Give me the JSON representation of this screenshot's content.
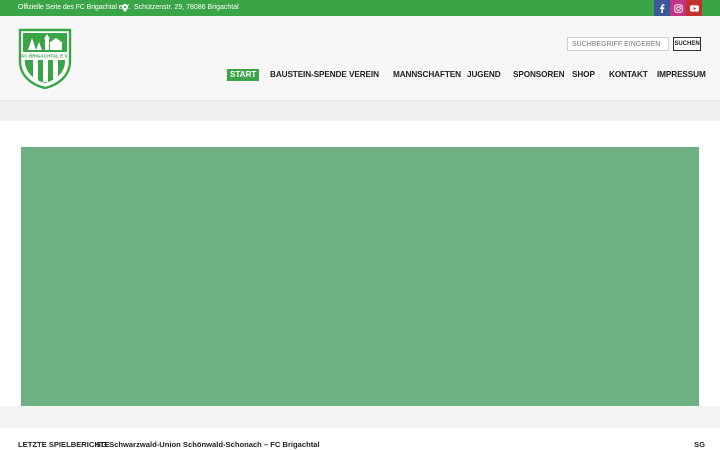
{
  "topbar": {
    "tagline": "Offizielle Seite des FC Brigachtal e.V.",
    "address": "Schützenstr. 29, 78086 Brigachtal",
    "social": [
      "facebook-icon",
      "instagram-icon",
      "youtube-icon"
    ],
    "background_color": "#3aa547"
  },
  "header": {
    "logo_text": "FC BRIGACHTAL E.V.",
    "search": {
      "placeholder": "SUCHBEGRIFF EINGEBEN",
      "value": "",
      "button_label": "SUCHEN"
    }
  },
  "nav": {
    "items": [
      {
        "label": "START",
        "active": true
      },
      {
        "label": "BAUSTEIN-SPENDE",
        "active": false
      },
      {
        "label": "VEREIN",
        "active": false
      },
      {
        "label": "MANNSCHAFTEN",
        "active": false
      },
      {
        "label": "JUGEND",
        "active": false
      },
      {
        "label": "SPONSOREN",
        "active": false
      },
      {
        "label": "SHOP",
        "active": false
      },
      {
        "label": "KONTAKT",
        "active": false
      },
      {
        "label": "IMPRESSUM",
        "active": false
      }
    ],
    "active_color": "#3aa547"
  },
  "hero": {
    "color": "#6fb083"
  },
  "ticker": {
    "label": "LETZTE SPIELBERICHTE",
    "items": [
      "SG Schwarzwald-Union Schönwald-Schonach – FC Brigachtal",
      "SG"
    ]
  }
}
